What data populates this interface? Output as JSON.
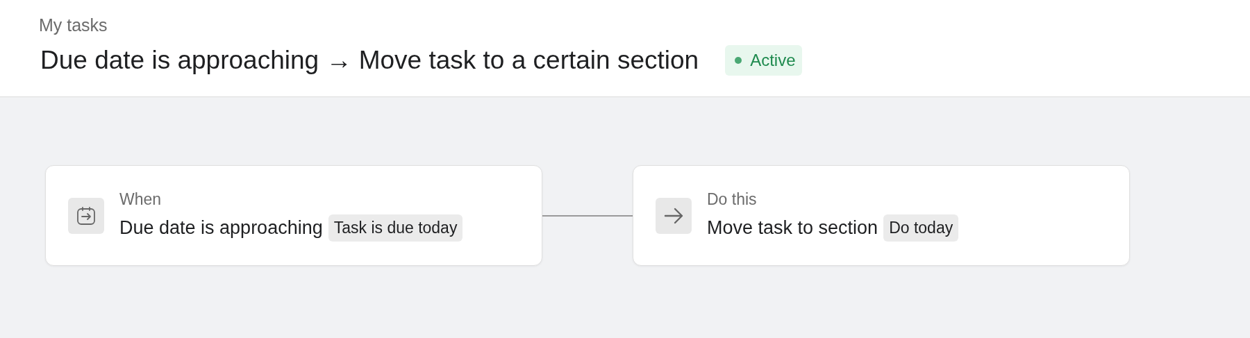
{
  "breadcrumb": "My tasks",
  "title": "Due date is approaching → Move task to a certain section",
  "status": {
    "label": "Active",
    "kind": "active"
  },
  "steps": [
    {
      "kind": "trigger",
      "label": "When",
      "text": "Due date is approaching",
      "tag": "Task is due today"
    },
    {
      "kind": "action",
      "label": "Do this",
      "text": "Move task to section",
      "tag": "Do today"
    }
  ]
}
